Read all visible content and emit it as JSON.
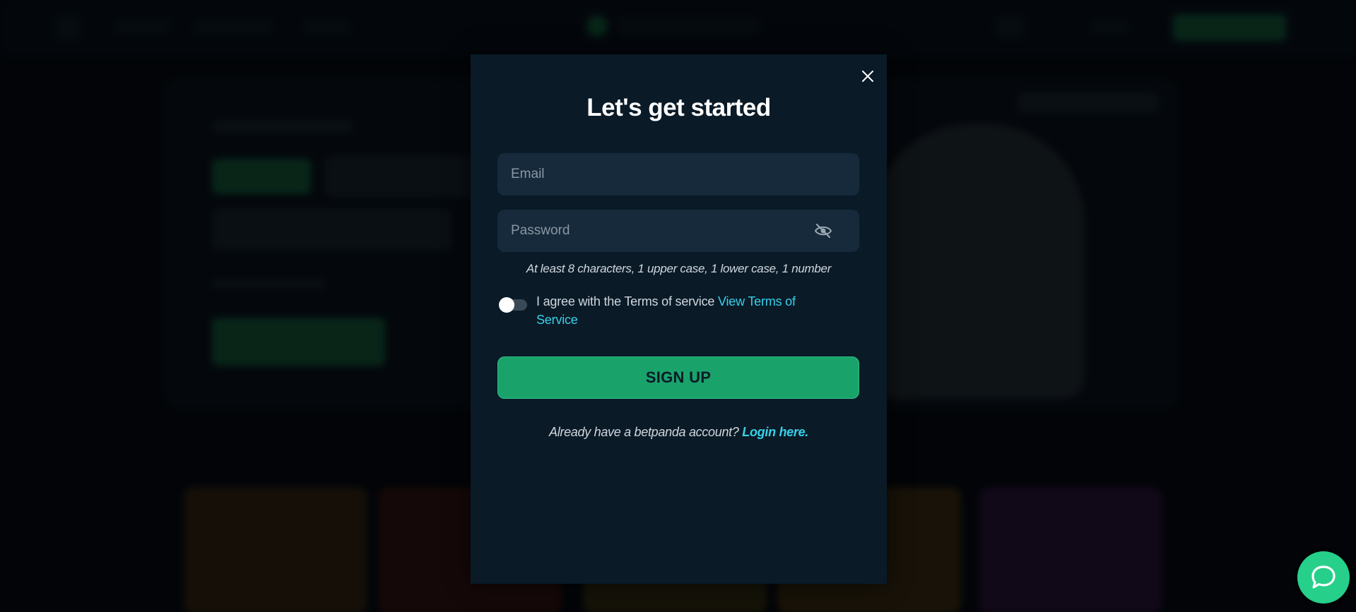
{
  "modal": {
    "title": "Let's get started",
    "email": {
      "placeholder": "Email",
      "value": ""
    },
    "password": {
      "placeholder": "Password",
      "value": ""
    },
    "password_hint": "At least 8 characters, 1 upper case, 1 lower case, 1 number",
    "terms": {
      "text": "I agree with the Terms of service",
      "link": "View Terms of Service",
      "accepted": false
    },
    "signup_label": "SIGN UP",
    "login_prompt": "Already have a betpanda account?",
    "login_link": "Login here."
  },
  "icons": {
    "close": "close-icon",
    "password_visibility": "eye-slash-icon",
    "chat": "chat-bubble-icon"
  },
  "colors": {
    "modal_bg": "#0a1a27",
    "field_bg": "#162a3b",
    "accent_green": "#19a36b",
    "link_cyan": "#38d0e8",
    "chat_green": "#26d08a"
  }
}
